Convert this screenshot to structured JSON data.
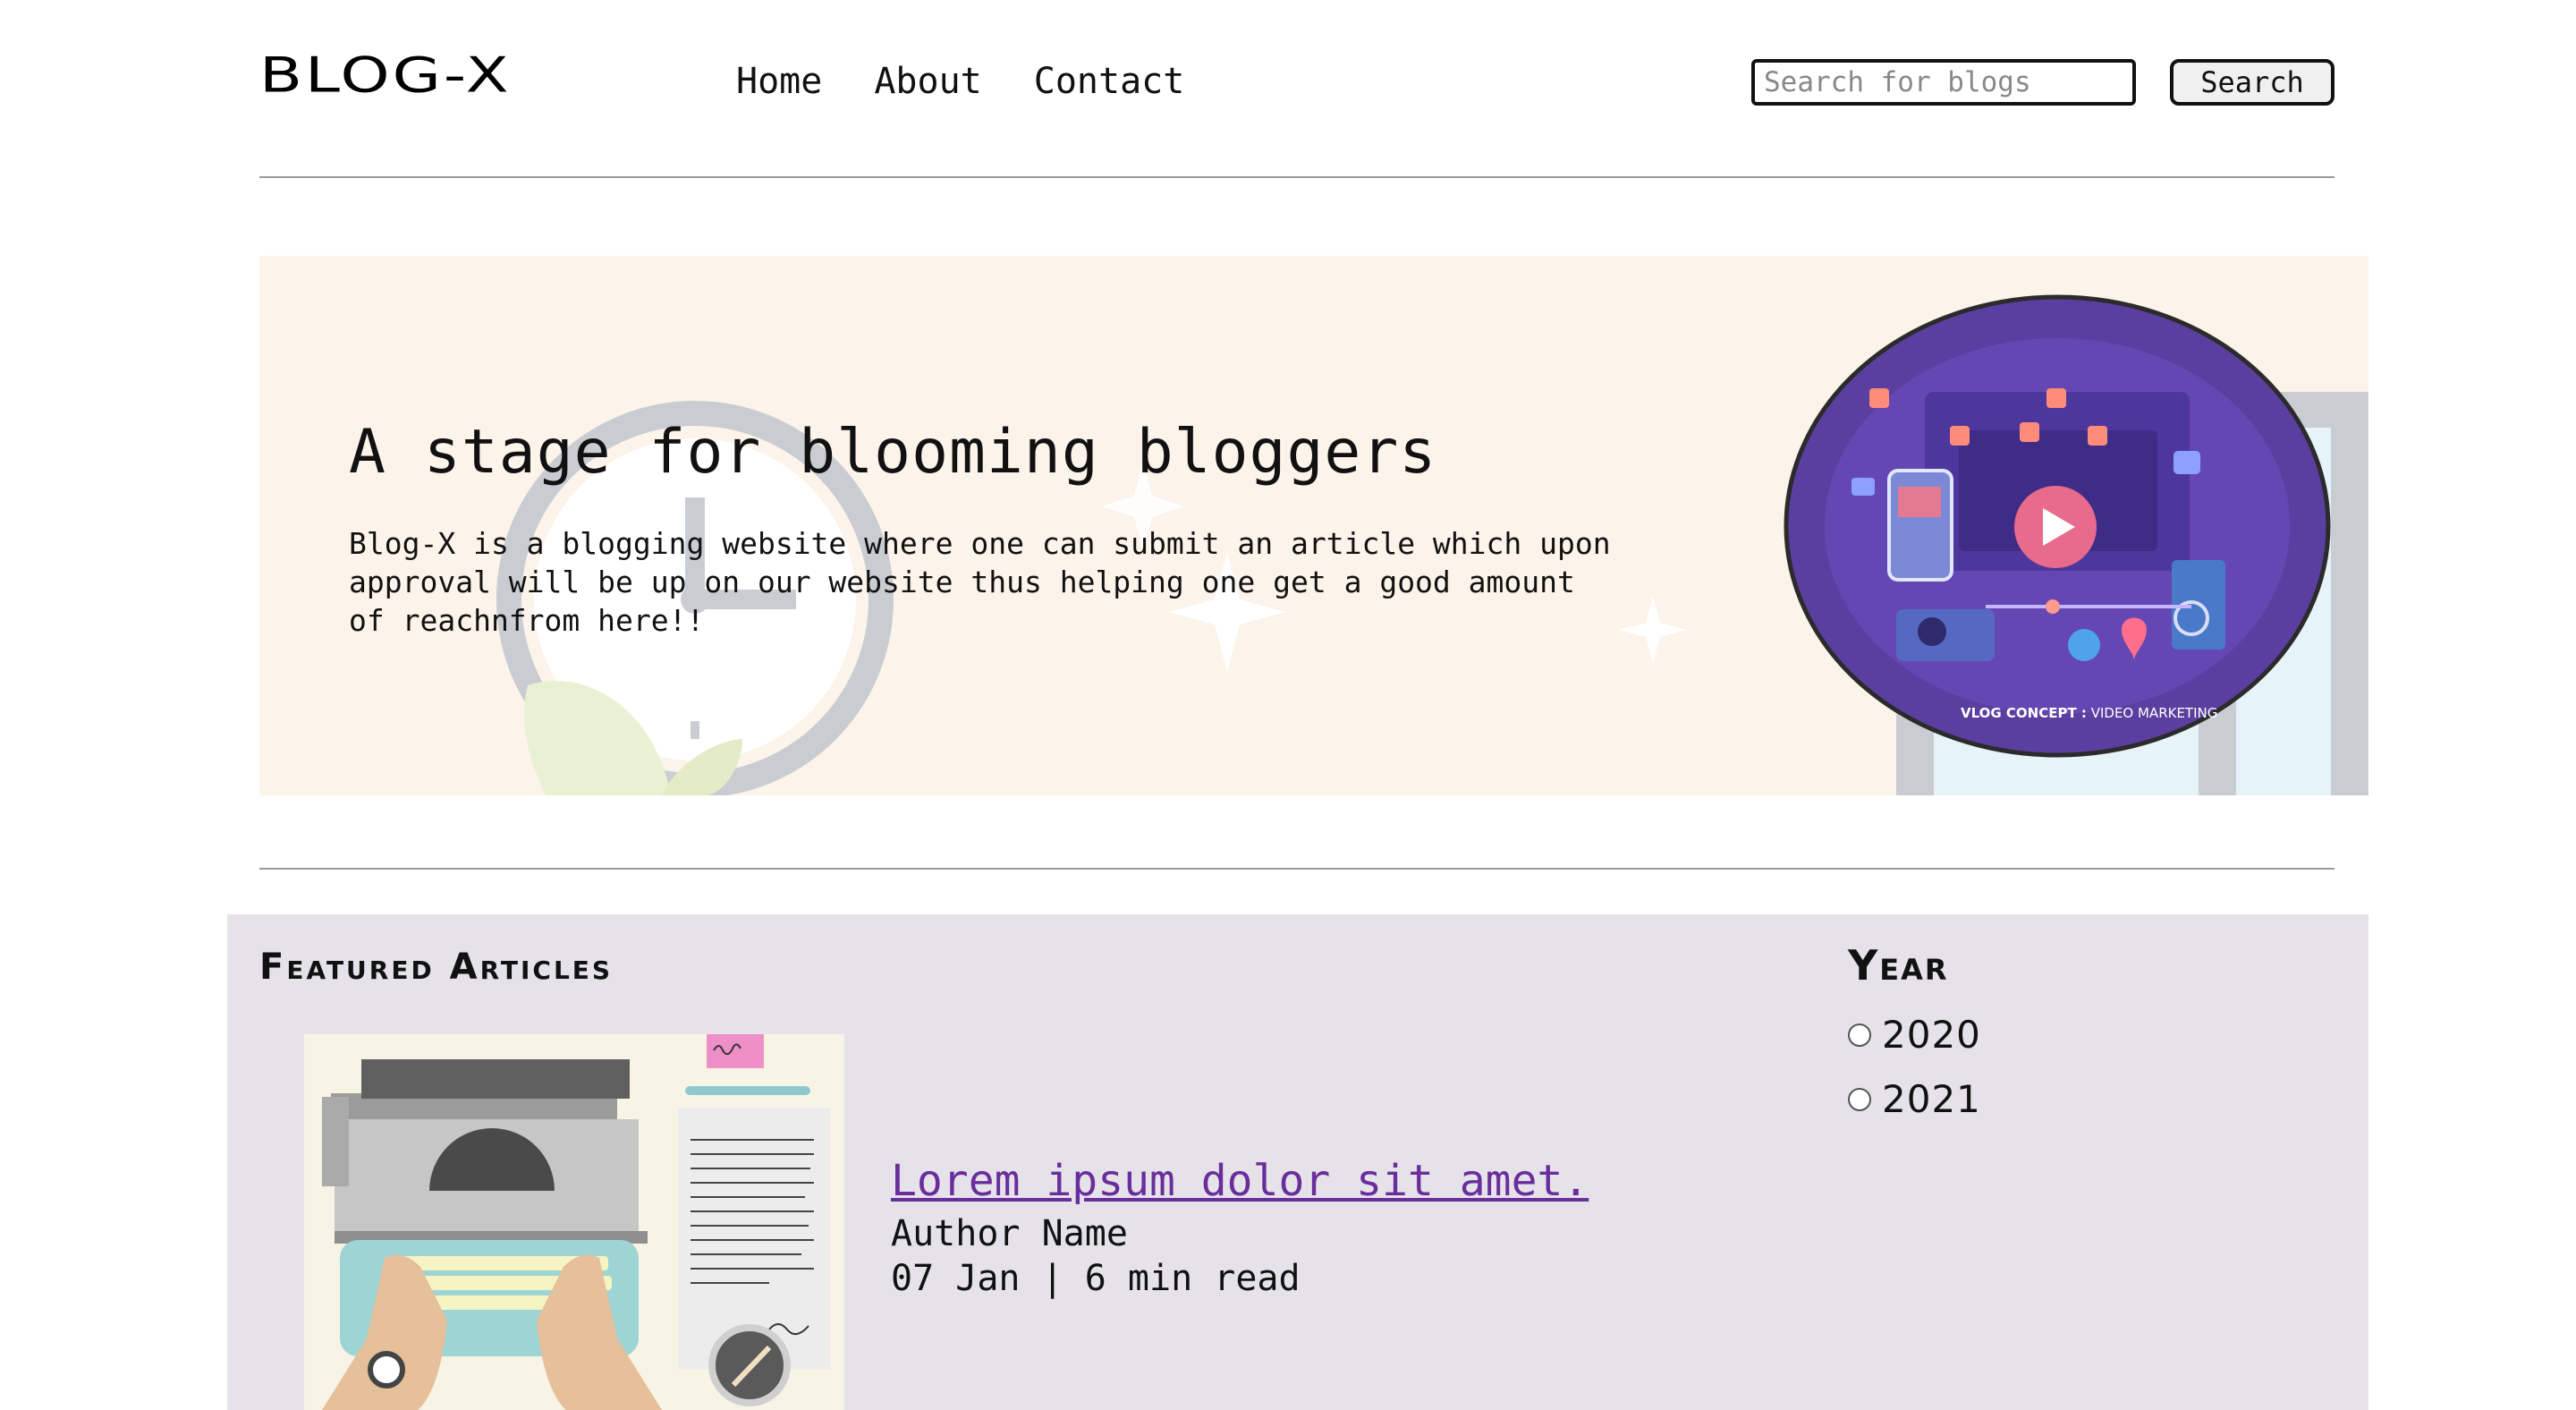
{
  "header": {
    "logo": "BLOG-X",
    "nav": [
      "Home",
      "About",
      "Contact"
    ],
    "search_placeholder": "Search for blogs",
    "search_button": "Search"
  },
  "hero": {
    "title": "A stage for blooming bloggers",
    "description": "Blog-X is a blogging website where one can submit an article which upon approval will be up on our website thus helping one get a good amount of reachnfrom here!!",
    "image_caption_bold": "VLOG CONCEPT :",
    "image_caption": " VIDEO MARKETING"
  },
  "featured": {
    "title": "Featured Articles",
    "articles": [
      {
        "title": "Lorem ipsum dolor sit amet.",
        "author": "Author Name",
        "meta": "07 Jan | 6 min read"
      }
    ]
  },
  "filter": {
    "title": "Year",
    "options": [
      "2020",
      "2021"
    ]
  },
  "colors": {
    "hero_bg": "#fcf3ea",
    "featured_bg": "#e5e3e9",
    "article_title": "#6a2d9c",
    "vlog_purple": "#5b3fa0"
  }
}
